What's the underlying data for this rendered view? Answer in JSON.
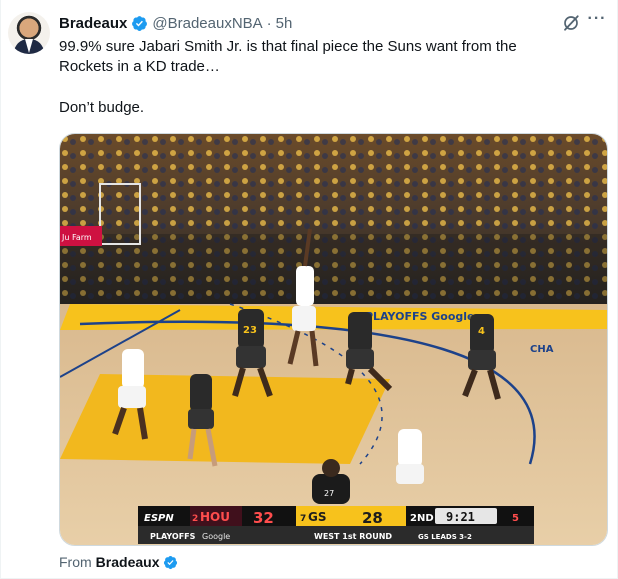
{
  "tweet": {
    "author": {
      "display_name": "Bradeaux",
      "handle": "@BradeauxNBA",
      "verified": true
    },
    "separator": "·",
    "timestamp": "5h",
    "text_line_1": "99.9% sure Jabari Smith Jr. is that final piece the Suns want from the",
    "text_line_2": "Rockets in a KD trade…",
    "text_line_3": "Don’t budge.",
    "attribution_prefix": "From",
    "attribution_name": "Bradeaux"
  },
  "media": {
    "scorebug": {
      "network": "ESPN",
      "away_seed": "2",
      "away_team": "HOU",
      "away_score": "32",
      "home_seed": "7",
      "home_team": "GS",
      "home_score": "28",
      "quarter": "2ND",
      "clock": "9:21",
      "shot_clock": "5",
      "sub_left": "PLAYOFFS",
      "sub_sponsor": "Google",
      "sub_round": "WEST 1st ROUND",
      "sub_series": "GS LEADS 3-2"
    },
    "court_text": {
      "playoffs_google": "PLAYOFFS Google",
      "baseline_cha": "CHA",
      "baseline_left": "Ju Farm",
      "jersey_23": "23",
      "jersey_4": "4",
      "jersey_27": "27"
    }
  },
  "icons": {
    "verified": "verified-badge-icon",
    "grok": "grok-icon",
    "more": "more-options-icon"
  },
  "colors": {
    "verified": "#1d9bf0",
    "muted": "#536471",
    "warriors_gold": "#ffc72c",
    "rockets_red": "#ce1141"
  }
}
